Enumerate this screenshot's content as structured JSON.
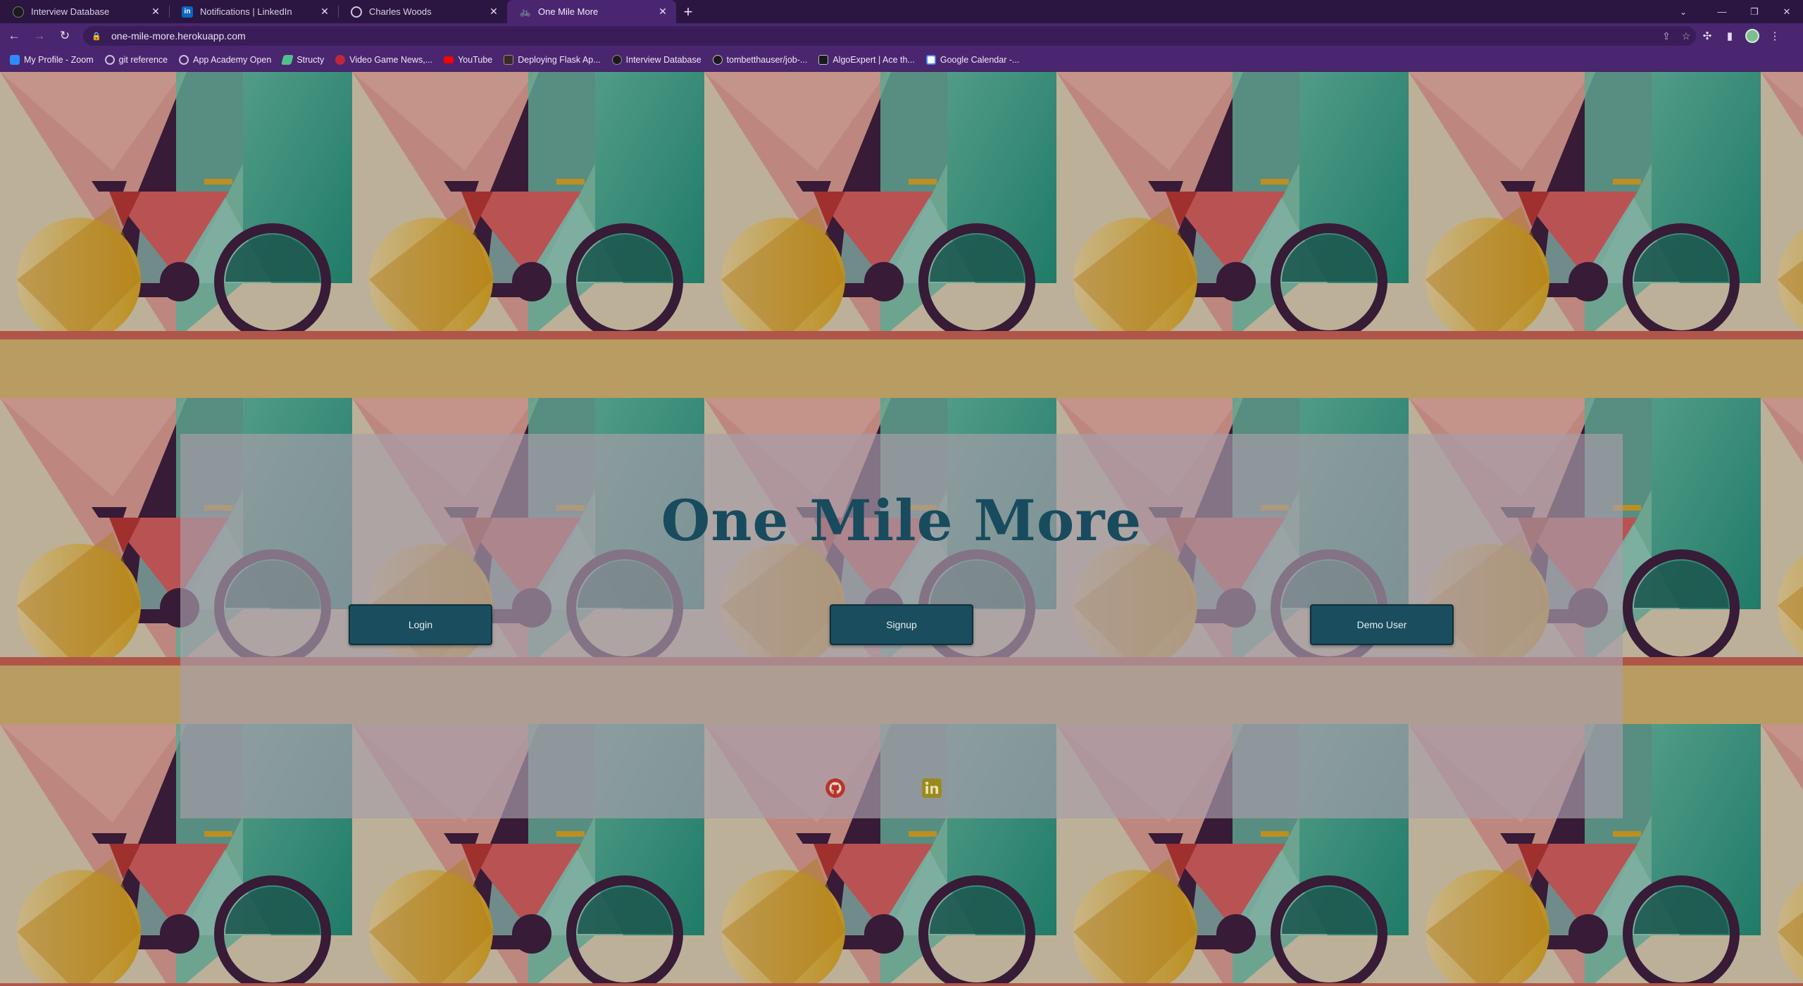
{
  "browser": {
    "tabs": [
      {
        "title": "Interview Database",
        "icon": "app-icon",
        "active": false
      },
      {
        "title": "Notifications | LinkedIn",
        "icon": "linkedin-icon",
        "active": false
      },
      {
        "title": "Charles Woods",
        "icon": "globe-icon",
        "active": false
      },
      {
        "title": "One Mile More",
        "icon": "bicycle-icon",
        "active": true
      }
    ],
    "new_tab_label": "+",
    "address": "one-mile-more.herokuapp.com",
    "bookmarks": [
      {
        "label": "My Profile - Zoom",
        "icon": "zoom-icon",
        "color": "#2d8cff"
      },
      {
        "label": "git reference",
        "icon": "globe-icon",
        "color": "#c9c0d6"
      },
      {
        "label": "App Academy Open",
        "icon": "globe-icon",
        "color": "#c9c0d6"
      },
      {
        "label": "Structy",
        "icon": "structy-icon",
        "color": "#4fc08d"
      },
      {
        "label": "Video Game News,...",
        "icon": "news-icon",
        "color": "#c0283a"
      },
      {
        "label": "YouTube",
        "icon": "youtube-icon",
        "color": "#ff0000"
      },
      {
        "label": "Deploying Flask Ap...",
        "icon": "doc-icon",
        "color": "#3a2a2a"
      },
      {
        "label": "Interview Database",
        "icon": "app-icon",
        "color": "#1a1a1a"
      },
      {
        "label": "tombetthauser/job-...",
        "icon": "github-icon",
        "color": "#1a1a1a"
      },
      {
        "label": "AlgoExpert | Ace th...",
        "icon": "algoexpert-icon",
        "color": "#1a1a1a"
      },
      {
        "label": "Google Calendar -...",
        "icon": "calendar-icon",
        "color": "#4285f4"
      }
    ]
  },
  "page": {
    "title": "One Mile More",
    "buttons": {
      "login": "Login",
      "signup": "Signup",
      "demo": "Demo User"
    },
    "social": [
      {
        "name": "github-icon",
        "color": "#b8342c"
      },
      {
        "name": "linkedin-icon",
        "color": "#9a8a1c"
      }
    ]
  },
  "colors": {
    "brand_teal": "#1a4e5e",
    "title_color": "#184b5e",
    "chrome_purple": "#4a2670"
  }
}
